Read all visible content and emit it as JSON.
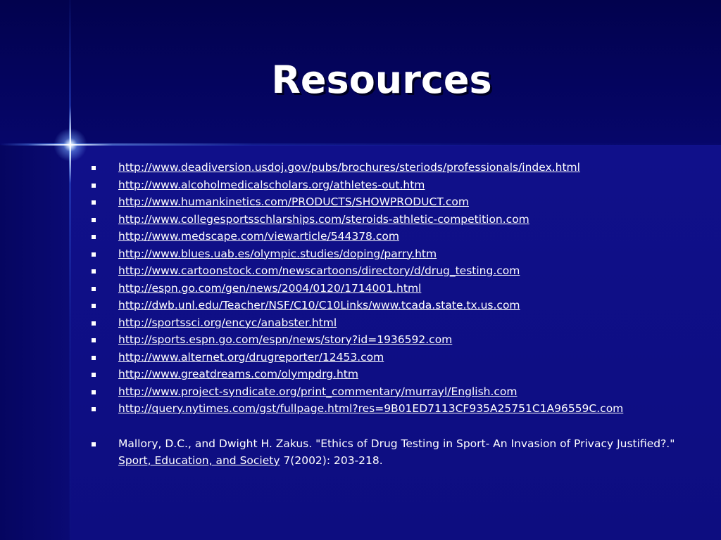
{
  "slide": {
    "title": "Resources",
    "links": [
      "http://www.deadiversion.usdoj.gov/pubs/brochures/steriods/professionals/index.html",
      "http://www.alcoholmedicalscholars.org/athletes-out.htm",
      "http://www.humankinetics.com/PRODUCTS/SHOWPRODUCT.com",
      "http://www.collegesportsschlarships.com/steroids-athletic-competition.com",
      "http://www.medscape.com/viewarticle/544378.com",
      "http://www.blues.uab.es/olympic.studies/doping/parry.htm",
      "http://www.cartoonstock.com/newscartoons/directory/d/drug_testing.com",
      "http://espn.go.com/gen/news/2004/0120/1714001.html",
      "http://dwb.unl.edu/Teacher/NSF/C10/C10Links/www.tcada.state.tx.us.com",
      "http://sportssci.org/encyc/anabster.html",
      "http://sports.espn.go.com/espn/news/story?id=1936592.com",
      "http://www.alternet.org/drugreporter/12453.com",
      "http://www.greatdreams.com/olympdrg.htm",
      "http://www.project-syndicate.org/print_commentary/murrayl/English.com",
      "http://query.nytimes.com/gst/fullpage.html?res=9B01ED7113CF935A25751C1A96559C.com"
    ],
    "citation": {
      "text_before": "Mallory, D.C., and Dwight H. Zakus. \"Ethics of Drug Testing in Sport- An Invasion of Privacy Justified?.\"",
      "journal": "Sport, Education, and Society",
      "text_after": " 7(2002): 203-218."
    }
  },
  "colors": {
    "background": "#0c0c7c",
    "top_band": "#02024e",
    "text": "#ffffff",
    "streak": "#78aaff"
  },
  "icons": {
    "bullet": "square-bullet-icon",
    "sparkle": "star-sparkle-icon"
  }
}
